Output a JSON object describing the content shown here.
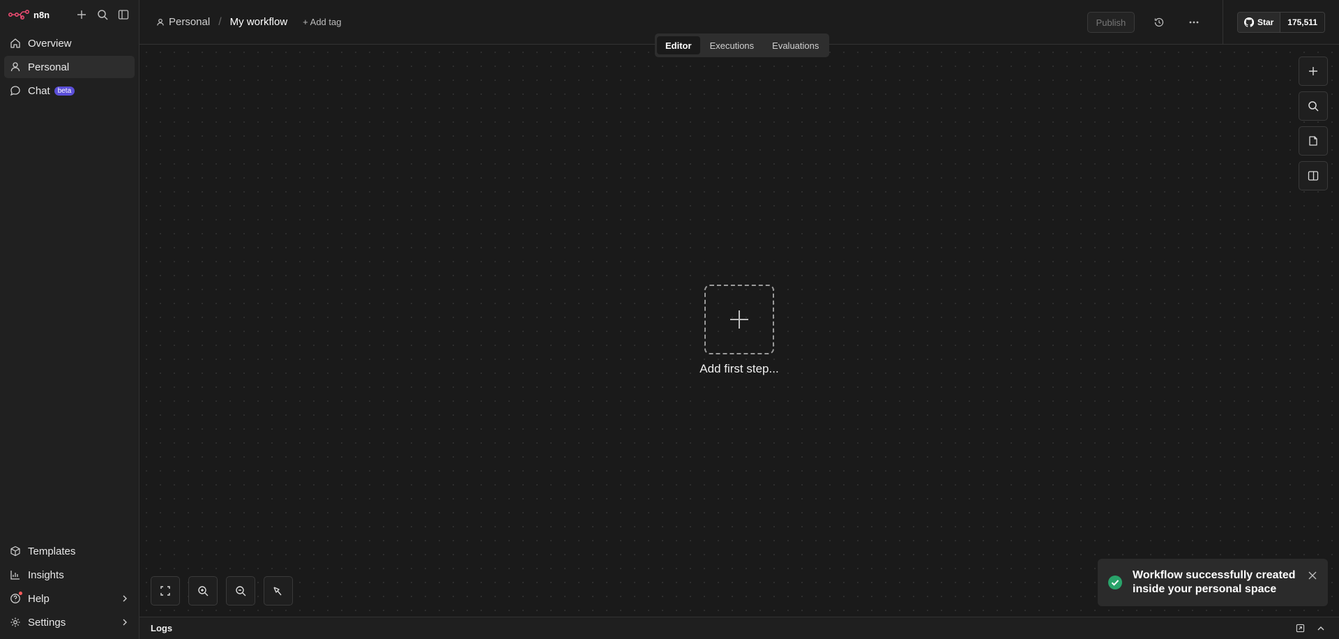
{
  "app": {
    "name": "n8n",
    "brand_color": "#ea4b71"
  },
  "sidebar": {
    "items": [
      {
        "label": "Overview",
        "icon": "home-icon"
      },
      {
        "label": "Personal",
        "icon": "user-icon"
      },
      {
        "label": "Chat",
        "icon": "chat-icon",
        "badge": "beta"
      }
    ],
    "bottom": [
      {
        "label": "Templates",
        "icon": "box-icon"
      },
      {
        "label": "Insights",
        "icon": "chart-icon"
      },
      {
        "label": "Help",
        "icon": "help-icon"
      },
      {
        "label": "Settings",
        "icon": "gear-icon"
      }
    ]
  },
  "header": {
    "project": "Personal",
    "workflow_name": "My workflow",
    "add_tag": "+ Add tag",
    "publish": "Publish",
    "github": {
      "star": "Star",
      "count": "175,511"
    }
  },
  "tabs": [
    "Editor",
    "Executions",
    "Evaluations"
  ],
  "canvas": {
    "add_first_step": "Add first step..."
  },
  "toast": {
    "message": "Workflow successfully created inside your personal space",
    "status_color": "#29a36a"
  },
  "logs": {
    "title": "Logs"
  }
}
